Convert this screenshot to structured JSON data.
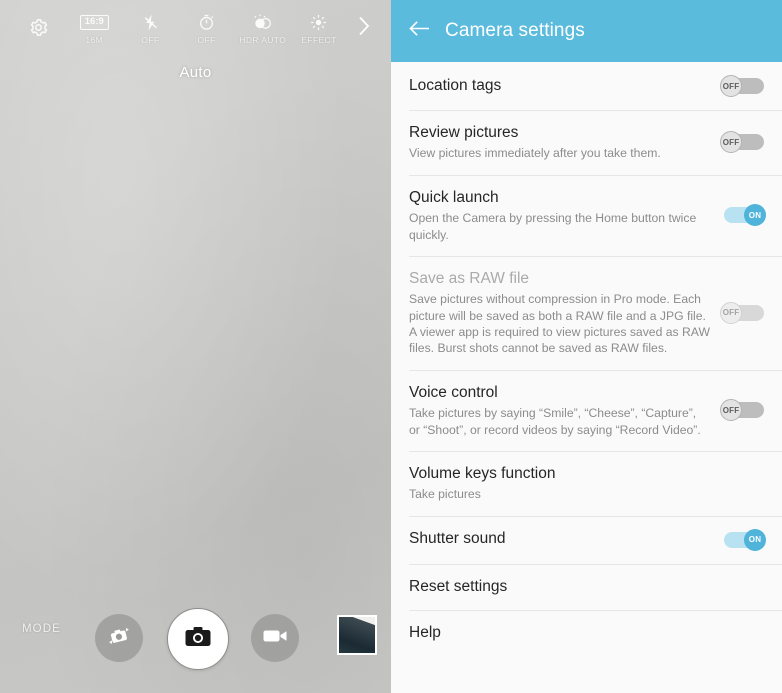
{
  "camera": {
    "mode_label": "Auto",
    "toolbar": [
      {
        "icon": "settings-gear-icon",
        "label": "",
        "value": ""
      },
      {
        "icon": "aspect-ratio-icon",
        "label": "16M",
        "value": "16:9"
      },
      {
        "icon": "flash-off-icon",
        "label": "OFF",
        "value": ""
      },
      {
        "icon": "timer-icon",
        "label": "OFF",
        "value": ""
      },
      {
        "icon": "hdr-icon",
        "label": "HDR AUTO",
        "value": ""
      },
      {
        "icon": "effect-icon",
        "label": "EFFECT",
        "value": ""
      }
    ],
    "next_icon": "chevron-right-icon",
    "bottom": {
      "mode_text": "MODE",
      "switch_camera_icon": "switch-camera-icon",
      "shutter_icon": "camera-shutter-icon",
      "video_icon": "video-camera-icon",
      "gallery_thumbnail": "gallery-thumbnail"
    }
  },
  "settings": {
    "back_icon": "back-arrow-icon",
    "title": "Camera settings",
    "accent_color": "#5bbbdd",
    "toggle_on_color": "#4fb3da",
    "toggle_off_color": "#bdbdbd",
    "rows": [
      {
        "title": "Location tags",
        "desc": "",
        "toggle": "OFF",
        "disabled": false
      },
      {
        "title": "Review pictures",
        "desc": "View pictures immediately after you take them.",
        "toggle": "OFF",
        "disabled": false
      },
      {
        "title": "Quick launch",
        "desc": "Open the Camera by pressing the Home button twice quickly.",
        "toggle": "ON",
        "disabled": false
      },
      {
        "title": "Save as RAW file",
        "desc": "Save pictures without compression in Pro mode. Each picture will be saved as both a RAW file and a JPG file. A viewer app is required to view pictures saved as RAW files. Burst shots cannot be saved as RAW files.",
        "toggle": "OFF",
        "disabled": true
      },
      {
        "title": "Voice control",
        "desc": "Take pictures by saying “Smile”, “Cheese”, “Capture”, or “Shoot”, or record videos by saying “Record Video”.",
        "toggle": "OFF",
        "disabled": false
      },
      {
        "title": "Volume keys function",
        "desc": "Take pictures",
        "toggle": "",
        "disabled": false
      },
      {
        "title": "Shutter sound",
        "desc": "",
        "toggle": "ON",
        "disabled": false
      },
      {
        "title": "Reset settings",
        "desc": "",
        "toggle": "",
        "disabled": false
      },
      {
        "title": "Help",
        "desc": "",
        "toggle": "",
        "disabled": false
      }
    ]
  }
}
